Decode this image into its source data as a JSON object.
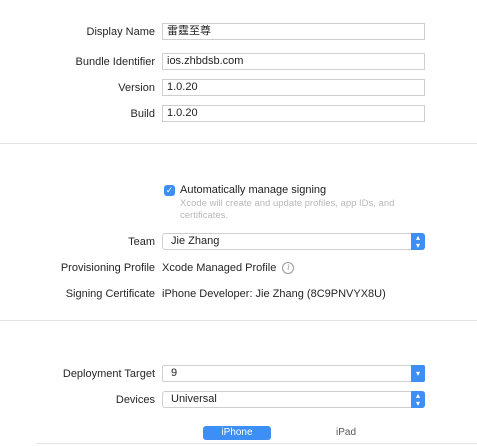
{
  "identity": {
    "display_name": {
      "label": "Display Name",
      "value": "雷霆至尊"
    },
    "bundle_identifier": {
      "label": "Bundle Identifier",
      "value": "ios.zhbdsb.com"
    },
    "version": {
      "label": "Version",
      "value": "1.0.20"
    },
    "build": {
      "label": "Build",
      "value": "1.0.20"
    }
  },
  "signing": {
    "auto_manage_label": "Automatically manage signing",
    "auto_manage_checked": true,
    "auto_manage_help": "Xcode will create and update profiles, app IDs, and certificates.",
    "team": {
      "label": "Team",
      "value": "Jie Zhang"
    },
    "provisioning_profile": {
      "label": "Provisioning Profile",
      "value": "Xcode Managed Profile"
    },
    "signing_certificate": {
      "label": "Signing Certificate",
      "value": "iPhone Developer: Jie Zhang (8C9PNVYX8U)"
    }
  },
  "deployment": {
    "target": {
      "label": "Deployment Target",
      "value": "9"
    },
    "devices": {
      "label": "Devices",
      "value": "Universal"
    },
    "device_tabs": [
      {
        "label": "iPhone",
        "selected": true
      },
      {
        "label": "iPad",
        "selected": false
      }
    ]
  },
  "colors": {
    "accent": "#3d8ef5",
    "separator": "#e3e3e3"
  },
  "icons": {
    "info": "info-circle-icon",
    "checkbox": "checkmark-icon",
    "popup": "chevron-up-down-icon",
    "dropdown": "chevron-down-icon"
  }
}
